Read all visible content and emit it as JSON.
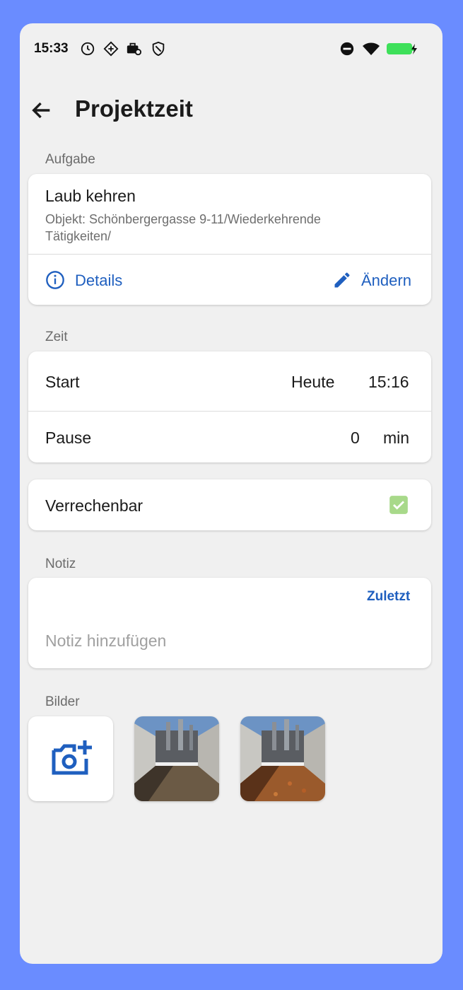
{
  "status_bar": {
    "time": "15:33",
    "icons": [
      "clock-icon",
      "sync-icon",
      "briefcase-icon",
      "shield-icon"
    ],
    "right_icons": [
      "do-not-disturb-icon",
      "wifi-icon",
      "battery-charging-icon"
    ]
  },
  "header": {
    "title": "Projektzeit",
    "back_icon": "arrow-left-icon"
  },
  "task": {
    "section_label": "Aufgabe",
    "name": "Laub kehren",
    "object_line1": "Objekt: Schönbergergasse 9-11/Wiederkehrende",
    "object_line2": "Tätigkeiten/",
    "details_label": "Details",
    "change_label": "Ändern"
  },
  "time": {
    "section_label": "Zeit",
    "start_label": "Start",
    "start_day": "Heute",
    "start_time": "15:16",
    "pause_label": "Pause",
    "pause_value": "0",
    "pause_unit": "min"
  },
  "billable": {
    "label": "Verrechenbar",
    "checked": true,
    "color": "#a8d98a"
  },
  "note": {
    "section_label": "Notiz",
    "recent_label": "Zuletzt",
    "placeholder": "Notiz hinzufügen"
  },
  "images": {
    "section_label": "Bilder",
    "add_icon": "add-photo-icon",
    "thumbnails": [
      "industrial-yard-photo",
      "industrial-yard-leaves-photo"
    ]
  },
  "colors": {
    "accent": "#1f5fbf",
    "background": "#f0f0f0",
    "frame": "#6a8cff"
  }
}
